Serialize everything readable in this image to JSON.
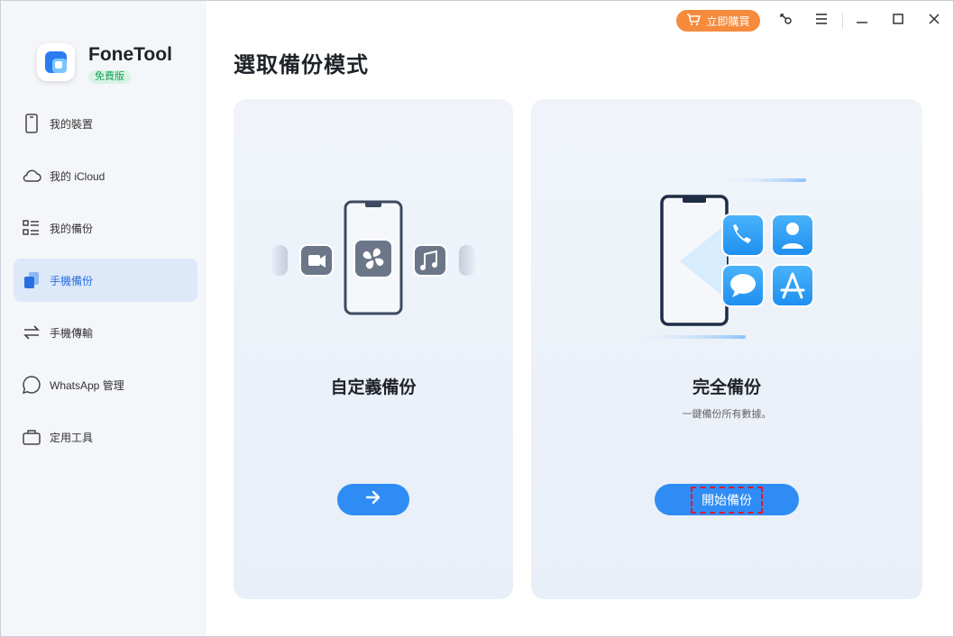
{
  "app": {
    "name": "FoneTool",
    "edition_badge": "免費版"
  },
  "titlebar": {
    "buy_label": "立即購買",
    "icons": [
      "cart-icon",
      "key-icon",
      "menu-icon",
      "minimize-icon",
      "maximize-icon",
      "close-icon"
    ]
  },
  "sidebar": {
    "items": [
      {
        "label": "我的裝置",
        "icon": "phone-icon",
        "active": false
      },
      {
        "label": "我的 iCloud",
        "icon": "cloud-icon",
        "active": false
      },
      {
        "label": "我的備份",
        "icon": "list-icon",
        "active": false
      },
      {
        "label": "手機備份",
        "icon": "backup-icon",
        "active": true
      },
      {
        "label": "手機傳輸",
        "icon": "transfer-icon",
        "active": false
      },
      {
        "label": "WhatsApp 管理",
        "icon": "whatsapp-icon",
        "active": false
      },
      {
        "label": "定用工具",
        "icon": "toolbox-icon",
        "active": false
      }
    ]
  },
  "main": {
    "title": "選取備份模式",
    "cards": [
      {
        "title": "自定義備份",
        "description": "",
        "button_icon": "arrow-right-icon"
      },
      {
        "title": "完全備份",
        "description": "一鍵備份所有數據。",
        "button_label": "開始備份"
      }
    ]
  },
  "colors": {
    "accent": "#2f8cf5",
    "buy": "#f68a3d",
    "active_nav_bg": "#dde8f8",
    "badge_green": "#1aa05a"
  }
}
